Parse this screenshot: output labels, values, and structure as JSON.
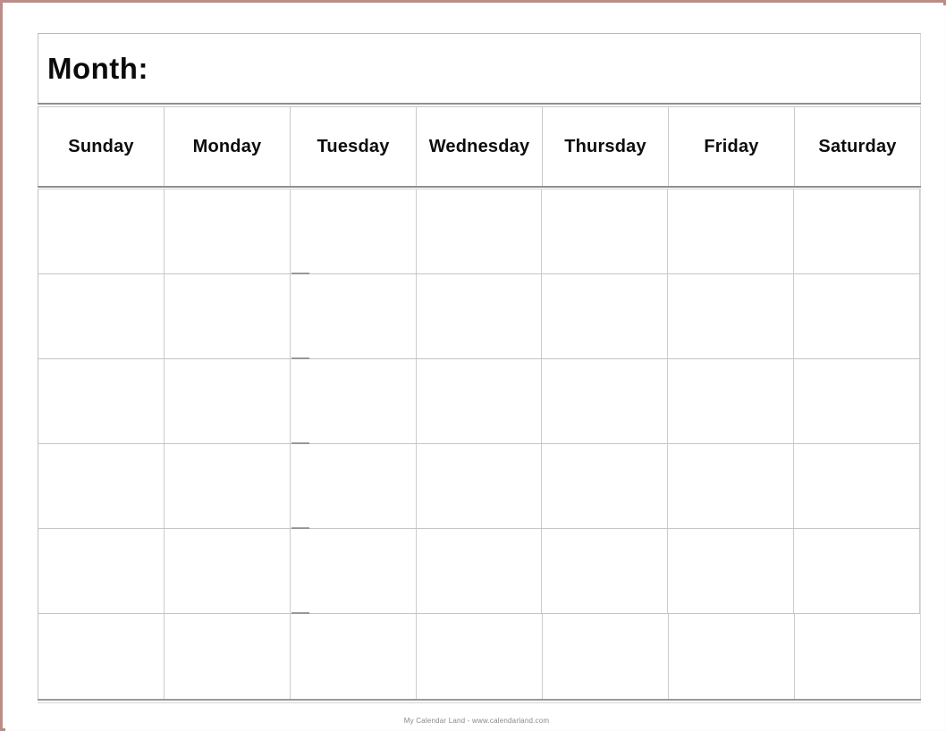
{
  "page": {
    "border_color": "#c08a86",
    "background_color": "#ffffff"
  },
  "calendar": {
    "title_label": "Month:",
    "weekday_headers": [
      "Sunday",
      "Monday",
      "Tuesday",
      "Wednesday",
      "Thursday",
      "Friday",
      "Saturday"
    ],
    "weeks": [
      {
        "days": [
          "",
          "",
          "",
          "",
          "",
          "",
          ""
        ]
      },
      {
        "days": [
          "",
          "",
          "",
          "",
          "",
          "",
          ""
        ]
      },
      {
        "days": [
          "",
          "",
          "",
          "",
          "",
          "",
          ""
        ]
      },
      {
        "days": [
          "",
          "",
          "",
          "",
          "",
          "",
          ""
        ]
      },
      {
        "days": [
          "",
          "",
          "",
          "",
          "",
          "",
          ""
        ]
      },
      {
        "days": [
          "",
          "",
          "",
          "",
          "",
          "",
          ""
        ]
      }
    ],
    "grid_line_color": "#c4c4c4",
    "rule_color": "#8f8f8f"
  },
  "footer": {
    "credit": "My Calendar Land - www.calendarland.com"
  }
}
